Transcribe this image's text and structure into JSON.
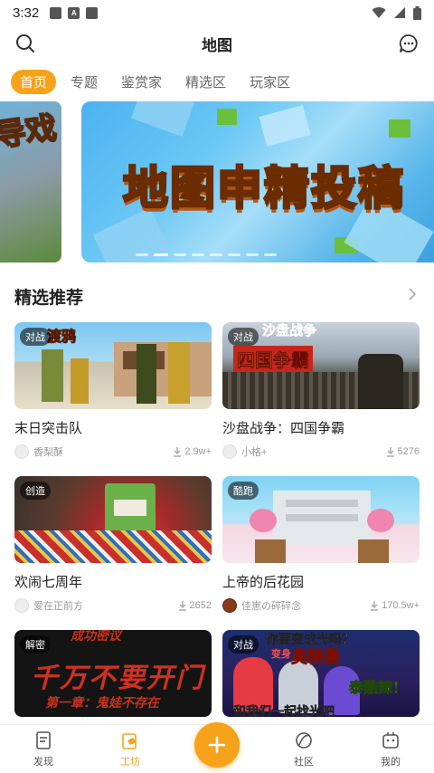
{
  "status": {
    "time": "3:32"
  },
  "header": {
    "title": "地图"
  },
  "tabs": [
    {
      "label": "首页",
      "active": true
    },
    {
      "label": "专题"
    },
    {
      "label": "鉴赏家"
    },
    {
      "label": "精选区"
    },
    {
      "label": "玩家区"
    }
  ],
  "banner": {
    "left_text": "导戏",
    "main_text": "地图申精投稿"
  },
  "section": {
    "title": "精选推荐"
  },
  "cards": [
    {
      "title": "末日突击队",
      "tag": "对战",
      "thumb_label": "渡鸦",
      "author": "香梨酥",
      "downloads": "2.9w+"
    },
    {
      "title": "沙盘战争：四国争霸",
      "tag": "对战",
      "thumb_label": "四国争霸",
      "thumb_label_top": "沙盘战争",
      "author": "小格+",
      "downloads": "5276"
    },
    {
      "title": "欢闹七周年",
      "tag": "创造",
      "author": "爱在正前方",
      "downloads": "2652"
    },
    {
      "title": "上帝的后花园",
      "tag": "酷跑",
      "author": "佳崽の碎碎念",
      "downloads": "170.5w+"
    },
    {
      "title": "",
      "tag": "解密",
      "thumb_label": "千万不要开门",
      "thumb_label_top": "成功密议",
      "thumb_label_bottom": "第一章：鬼娃不存在"
    },
    {
      "title": "",
      "tag": "对战",
      "thumb_label": "奥特曼",
      "thumb_label_top": "你要变成光吗？",
      "thumb_label_side": "变身",
      "thumb_label_right": "泰酷辣！",
      "thumb_label_bottom": "和我们一起找光吧"
    }
  ],
  "bottom_nav": [
    {
      "label": "发现",
      "icon": "discover-icon"
    },
    {
      "label": "工坊",
      "icon": "workshop-icon",
      "active": true
    },
    {
      "label": "",
      "icon": "plus-icon"
    },
    {
      "label": "社区",
      "icon": "community-icon"
    },
    {
      "label": "我的",
      "icon": "profile-icon"
    }
  ],
  "colors": {
    "accent": "#f7a21b",
    "text": "#222222",
    "muted": "#999999"
  }
}
